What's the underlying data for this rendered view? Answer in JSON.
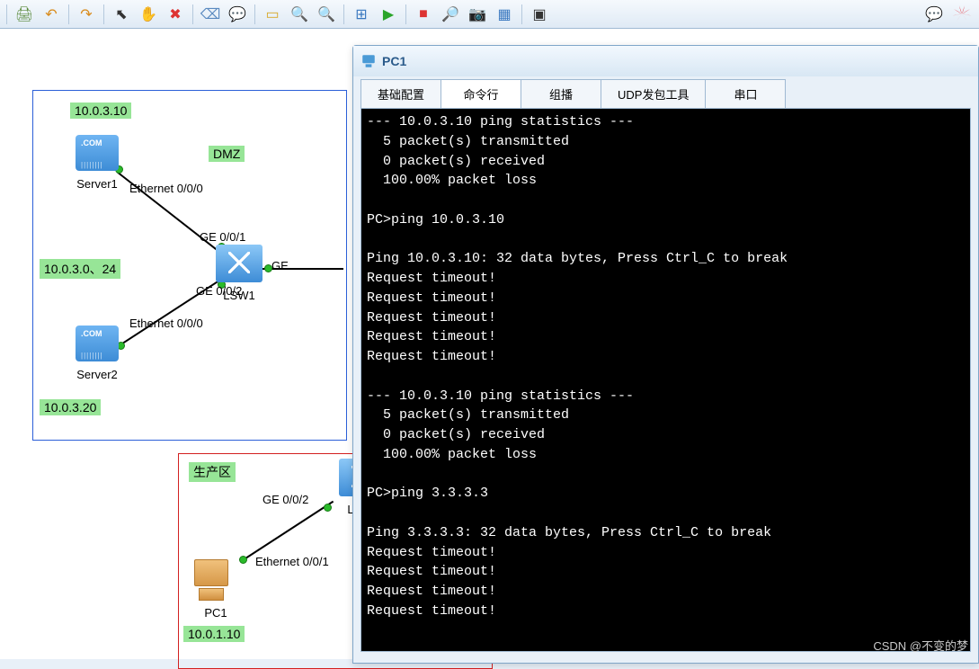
{
  "toolbar": {
    "icons": [
      {
        "name": "print-icon",
        "glyph": "🖨",
        "color": "#5a8a3a"
      },
      {
        "name": "undo-icon",
        "glyph": "↶",
        "color": "#d88a1a"
      },
      {
        "name": "redo-icon",
        "glyph": "↷",
        "color": "#d88a1a"
      },
      {
        "name": "pointer-icon",
        "glyph": "⬉",
        "color": "#333"
      },
      {
        "name": "hand-icon",
        "glyph": "✋",
        "color": "#d88a1a"
      },
      {
        "name": "delete-icon",
        "glyph": "✖",
        "color": "#d33"
      },
      {
        "name": "erase-icon",
        "glyph": "⌫",
        "color": "#5a8ac0"
      },
      {
        "name": "annotate-icon",
        "glyph": "💬",
        "color": "#7aa"
      },
      {
        "name": "note-icon",
        "glyph": "▭",
        "color": "#d8a82a"
      },
      {
        "name": "zoom-in-icon",
        "glyph": "🔍",
        "color": "#5a8a3a"
      },
      {
        "name": "zoom-out-icon",
        "glyph": "🔍",
        "color": "#5a8a3a"
      },
      {
        "name": "fit-icon",
        "glyph": "⊞",
        "color": "#3a78c0"
      },
      {
        "name": "play-icon",
        "glyph": "▶",
        "color": "#2aa52a"
      },
      {
        "name": "stop-icon",
        "glyph": "■",
        "color": "#d33"
      },
      {
        "name": "inspect-icon",
        "glyph": "🔎",
        "color": "#3a78c0"
      },
      {
        "name": "capture-icon",
        "glyph": "📷",
        "color": "#3a78c0"
      },
      {
        "name": "grid-icon",
        "glyph": "▦",
        "color": "#3a78c0"
      },
      {
        "name": "screen-icon",
        "glyph": "▣",
        "color": "#333"
      }
    ],
    "right_icons": [
      {
        "name": "feedback-icon",
        "glyph": "💬",
        "color": "#5a8ac0"
      }
    ]
  },
  "topology": {
    "dmz_label": "DMZ",
    "server1": {
      "name": "Server1",
      "ip": "10.0.3.10",
      "port": "Ethernet 0/0/0"
    },
    "server2": {
      "name": "Server2",
      "ip": "10.0.3.20",
      "port": "Ethernet 0/0/0"
    },
    "subnet": "10.0.3.0、24",
    "switch": {
      "name": "LSW1",
      "p1": "GE 0/0/1",
      "p2": "GE 0/0/2",
      "p_out": "GE"
    },
    "prod_label": "生产区",
    "switch2": {
      "p_top": "GE 0/0/2",
      "name": "L"
    },
    "pc1": {
      "name": "PC1",
      "port": "Ethernet 0/0/1",
      "ip": "10.0.1.10"
    }
  },
  "terminal": {
    "title": "PC1",
    "tabs": [
      "基础配置",
      "命令行",
      "组播",
      "UDP发包工具",
      "串口"
    ],
    "active_tab": 1,
    "lines": [
      "--- 10.0.3.10 ping statistics ---",
      "  5 packet(s) transmitted",
      "  0 packet(s) received",
      "  100.00% packet loss",
      "",
      "PC>ping 10.0.3.10",
      "",
      "Ping 10.0.3.10: 32 data bytes, Press Ctrl_C to break",
      "Request timeout!",
      "Request timeout!",
      "Request timeout!",
      "Request timeout!",
      "Request timeout!",
      "",
      "--- 10.0.3.10 ping statistics ---",
      "  5 packet(s) transmitted",
      "  0 packet(s) received",
      "  100.00% packet loss",
      "",
      "PC>ping 3.3.3.3",
      "",
      "Ping 3.3.3.3: 32 data bytes, Press Ctrl_C to break",
      "Request timeout!",
      "Request timeout!",
      "Request timeout!",
      "Request timeout!"
    ]
  },
  "watermark": "CSDN @不变的梦"
}
